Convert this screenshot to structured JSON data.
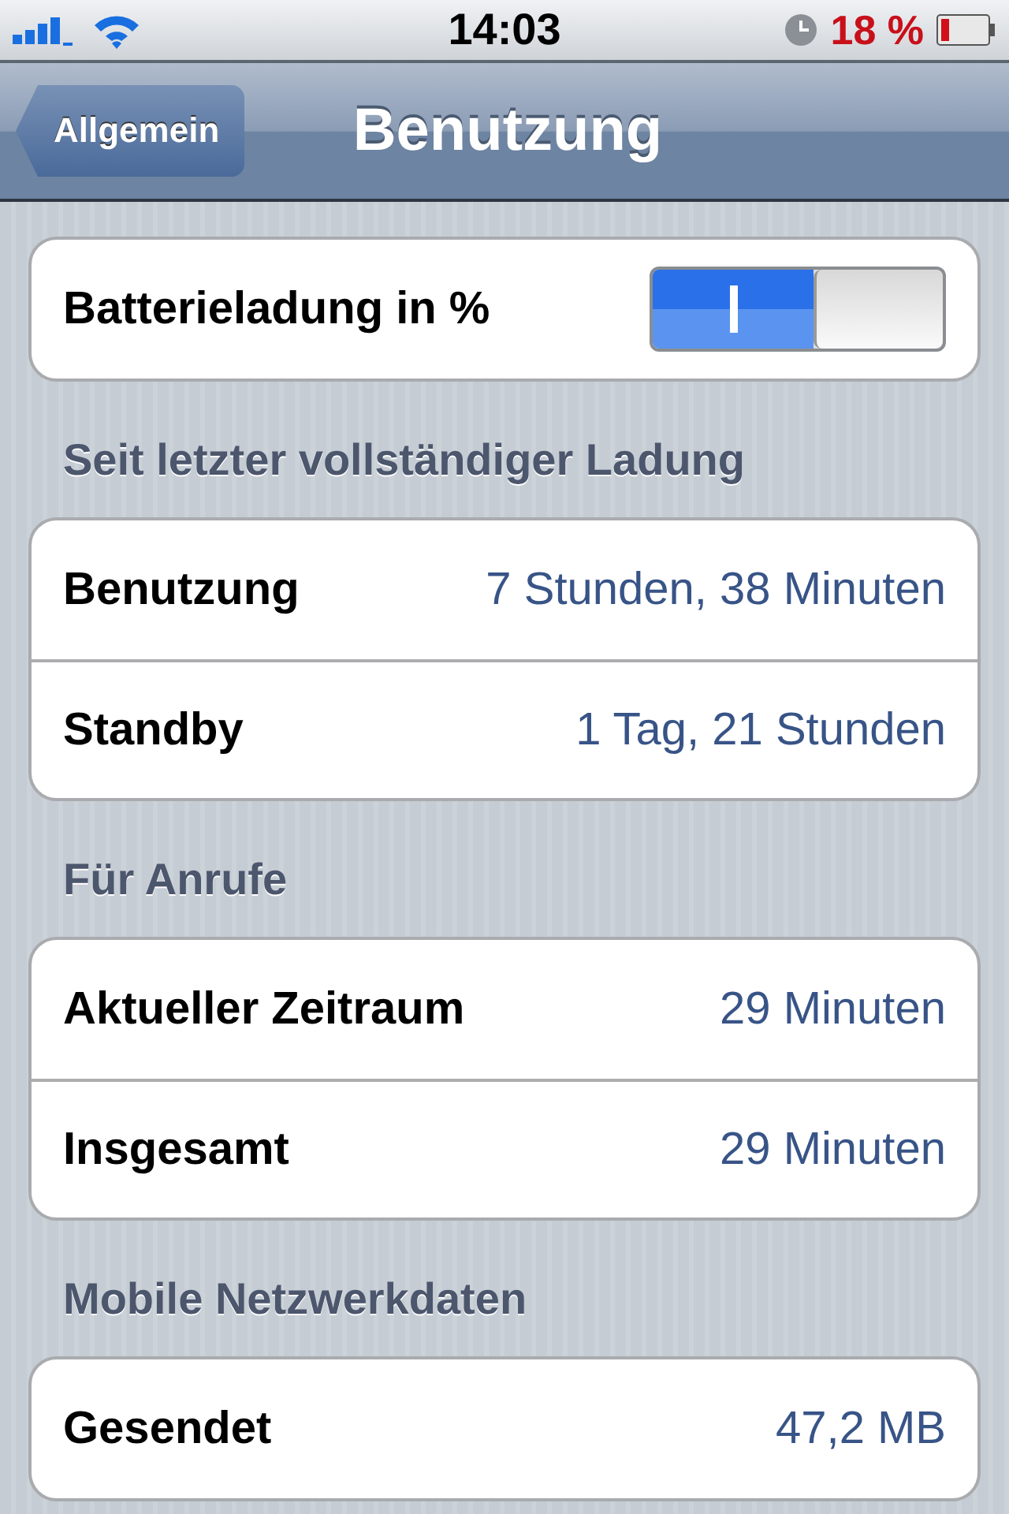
{
  "status_bar": {
    "time": "14:03",
    "battery_text": "18 %"
  },
  "nav_bar": {
    "back": "Allgemein",
    "title": "Benutzung"
  },
  "sections": [
    {
      "rows": [
        {
          "kind": "switch",
          "label": "Batterieladung in %",
          "on": true
        }
      ]
    },
    {
      "header": "Seit letzter vollständiger Ladung",
      "rows": [
        {
          "kind": "value",
          "label": "Benutzung",
          "value": "7 Stunden, 38 Minuten"
        },
        {
          "kind": "value",
          "label": "Standby",
          "value": "1 Tag, 21 Stunden"
        }
      ]
    },
    {
      "header": "Für Anrufe",
      "rows": [
        {
          "kind": "value",
          "label": "Aktueller Zeitraum",
          "value": "29 Minuten"
        },
        {
          "kind": "value",
          "label": "Insgesamt",
          "value": "29 Minuten"
        }
      ]
    },
    {
      "header": "Mobile Netzwerkdaten",
      "rows": [
        {
          "kind": "value",
          "label": "Gesendet",
          "value": "47,2 MB"
        }
      ]
    }
  ]
}
